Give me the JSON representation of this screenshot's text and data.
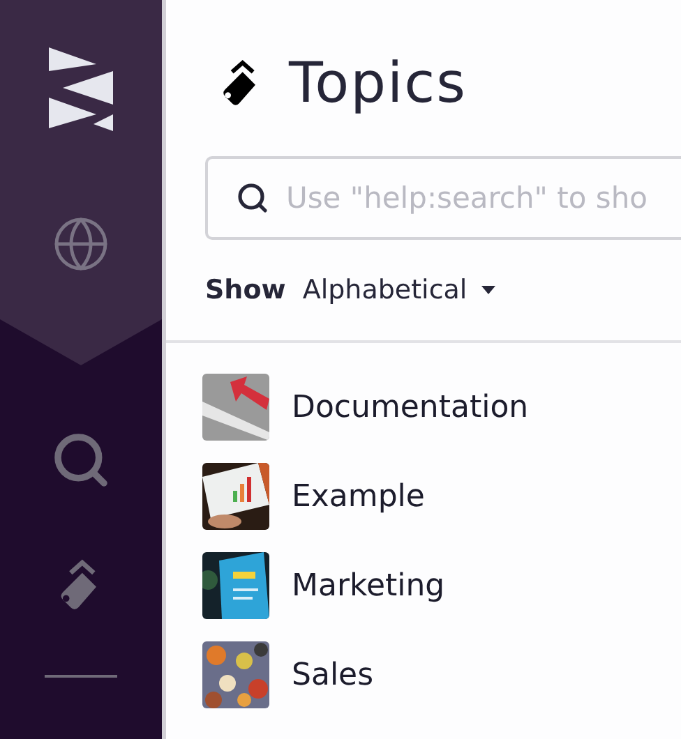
{
  "page": {
    "title": "Topics"
  },
  "search": {
    "placeholder": "Use \"help:search\" to sho"
  },
  "sort": {
    "label": "Show",
    "value": "Alphabetical"
  },
  "topics": [
    {
      "name": "Documentation",
      "kind": "picture"
    },
    {
      "name": "Example",
      "kind": "picture"
    },
    {
      "name": "Marketing",
      "kind": "picture"
    },
    {
      "name": "Sales",
      "kind": "picture"
    }
  ]
}
